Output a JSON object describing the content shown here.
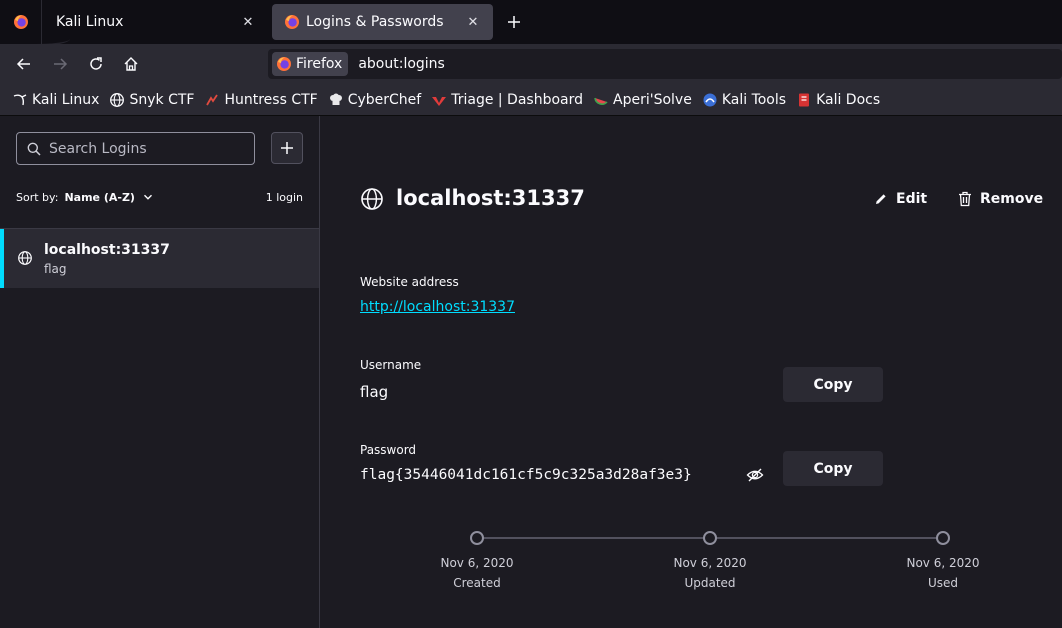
{
  "tabs": [
    {
      "label": "Kali Linux",
      "active": false
    },
    {
      "label": "Logins & Passwords",
      "active": true
    }
  ],
  "navbar": {
    "identity_label": "Firefox",
    "url": "about:logins"
  },
  "bookmarks": [
    {
      "label": "Kali Linux",
      "icon": "kali-dragon-icon"
    },
    {
      "label": "Snyk CTF",
      "icon": "globe-icon"
    },
    {
      "label": "Huntress CTF",
      "icon": "huntress-icon"
    },
    {
      "label": "CyberChef",
      "icon": "chef-icon"
    },
    {
      "label": "Triage | Dashboard",
      "icon": "triage-icon"
    },
    {
      "label": "Aperi'Solve",
      "icon": "watermelon-icon"
    },
    {
      "label": "Kali Tools",
      "icon": "kali-tools-icon"
    },
    {
      "label": "Kali Docs",
      "icon": "kali-docs-icon"
    }
  ],
  "sidebar": {
    "search_placeholder": "Search Logins",
    "add_label": "+",
    "sort_label": "Sort by:",
    "sort_value": "Name (A-Z)",
    "count": "1 login",
    "items": [
      {
        "title": "localhost:31337",
        "subtitle": "flag"
      }
    ]
  },
  "detail": {
    "title": "localhost:31337",
    "edit_label": "Edit",
    "remove_label": "Remove",
    "website_label": "Website address",
    "website_value": "http://localhost:31337",
    "username_label": "Username",
    "username_value": "flag",
    "password_label": "Password",
    "password_value": "flag{35446041dc161cf5c9c325a3d28af3e3}",
    "copy_label": "Copy",
    "timeline": [
      {
        "date": "Nov 6, 2020",
        "label": "Created"
      },
      {
        "date": "Nov 6, 2020",
        "label": "Updated"
      },
      {
        "date": "Nov 6, 2020",
        "label": "Used"
      }
    ]
  },
  "colors": {
    "accent": "#00ddff",
    "background": "#1c1b22",
    "surface": "#2b2a33"
  }
}
